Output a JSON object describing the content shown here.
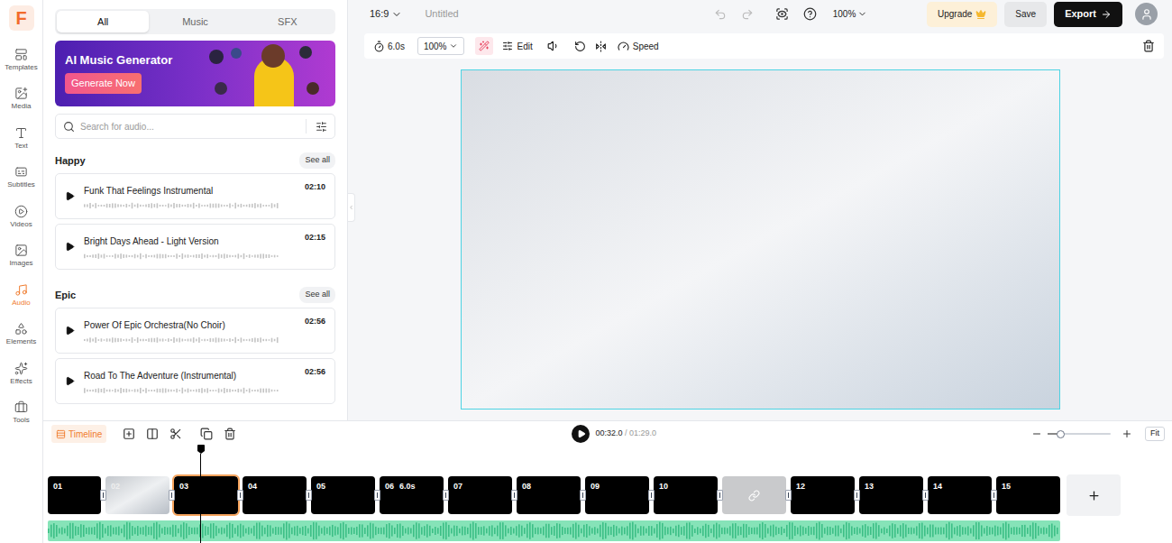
{
  "logo": "F",
  "rail": [
    {
      "label": "Templates",
      "selected": false
    },
    {
      "label": "Media",
      "selected": false
    },
    {
      "label": "Text",
      "selected": false
    },
    {
      "label": "Subtitles",
      "selected": false
    },
    {
      "label": "Videos",
      "selected": false
    },
    {
      "label": "Images",
      "selected": false
    },
    {
      "label": "Audio",
      "selected": true
    },
    {
      "label": "Elements",
      "selected": false
    },
    {
      "label": "Effects",
      "selected": false
    },
    {
      "label": "Tools",
      "selected": false
    }
  ],
  "panel": {
    "tabs": [
      {
        "label": "All",
        "selected": true
      },
      {
        "label": "Music",
        "selected": false
      },
      {
        "label": "SFX",
        "selected": false
      }
    ],
    "banner": {
      "title": "AI Music Generator",
      "button": "Generate Now"
    },
    "search": {
      "placeholder": "Search for audio..."
    },
    "sections": [
      {
        "title": "Happy",
        "action": "See all",
        "tracks": [
          {
            "title": "Funk That Feelings Instrumental",
            "duration": "02:10"
          },
          {
            "title": "Bright Days Ahead - Light Version",
            "duration": "02:15"
          }
        ]
      },
      {
        "title": "Epic",
        "action": "See all",
        "tracks": [
          {
            "title": "Power Of Epic Orchestra(No Choir)",
            "duration": "02:56"
          },
          {
            "title": "Road To The Adventure (Instrumental)",
            "duration": "02:56"
          }
        ]
      }
    ]
  },
  "topbar": {
    "aspect": "16:9",
    "title": "Untitled",
    "zoom": "100%",
    "upgrade": "Upgrade",
    "save": "Save",
    "export": "Export"
  },
  "toolbar": {
    "duration": "6.0s",
    "scale": "100%",
    "edit": "Edit",
    "speed": "Speed"
  },
  "timeline": {
    "label": "Timeline",
    "time": "00:32.0",
    "separator": "/",
    "total": "01:29.0",
    "fit": "Fit",
    "zoom_level": 0.2,
    "playhead_level": 0.151,
    "clips": [
      {
        "label": "01",
        "kind": "video",
        "selected": false
      },
      {
        "label": "02",
        "kind": "image",
        "selected": false
      },
      {
        "label": "03",
        "kind": "video",
        "selected": true
      },
      {
        "label": "04",
        "kind": "video",
        "selected": false
      },
      {
        "label": "05",
        "kind": "video",
        "selected": false
      },
      {
        "label": "06",
        "kind": "video",
        "selected": false,
        "duration": "6.0s"
      },
      {
        "label": "07",
        "kind": "video",
        "selected": false
      },
      {
        "label": "08",
        "kind": "video",
        "selected": false
      },
      {
        "label": "09",
        "kind": "video",
        "selected": false
      },
      {
        "label": "10",
        "kind": "video",
        "selected": false
      },
      {
        "label": "",
        "kind": "link",
        "selected": false
      },
      {
        "label": "12",
        "kind": "video",
        "selected": false
      },
      {
        "label": "13",
        "kind": "video",
        "selected": false
      },
      {
        "label": "14",
        "kind": "video",
        "selected": false
      },
      {
        "label": "15",
        "kind": "video",
        "selected": false
      }
    ]
  }
}
